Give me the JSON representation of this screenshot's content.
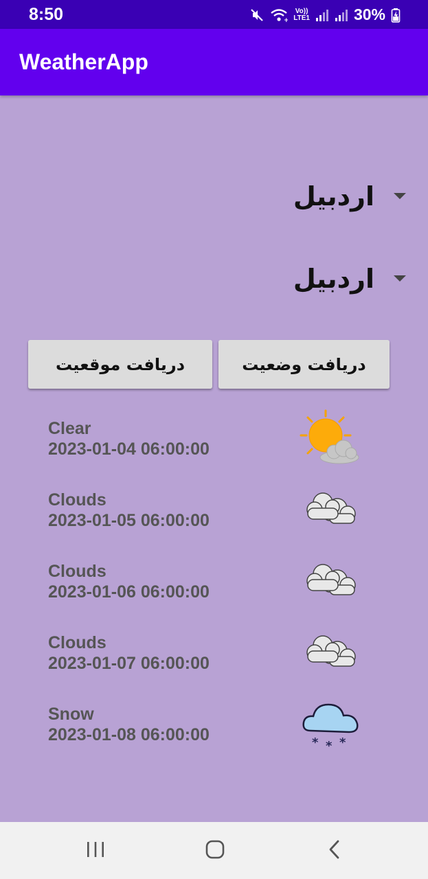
{
  "status_bar": {
    "time": "8:50",
    "lte_top": "Vo))",
    "lte_bottom": "LTE1",
    "battery": "30%"
  },
  "app_bar": {
    "title": "WeatherApp"
  },
  "spinners": {
    "province": "اردبیل",
    "city": "اردبیل"
  },
  "buttons": {
    "get_status": "دریافت وضعیت",
    "get_location": "دریافت موقعیت"
  },
  "forecast": [
    {
      "condition": "Clear",
      "date": "2023-01-04 06:00:00",
      "icon": "sun-behind-cloud-icon"
    },
    {
      "condition": "Clouds",
      "date": "2023-01-05 06:00:00",
      "icon": "clouds-icon"
    },
    {
      "condition": "Clouds",
      "date": "2023-01-06 06:00:00",
      "icon": "clouds-icon"
    },
    {
      "condition": "Clouds",
      "date": "2023-01-07 06:00:00",
      "icon": "clouds-icon"
    },
    {
      "condition": "Snow",
      "date": "2023-01-08 06:00:00",
      "icon": "snow-cloud-icon"
    }
  ],
  "colors": {
    "status_bar": "#3a00b4",
    "app_bar": "#6200ee",
    "background": "#b8a2d4",
    "button": "#dcdcdc",
    "nav_bar": "#f1f1f1"
  }
}
